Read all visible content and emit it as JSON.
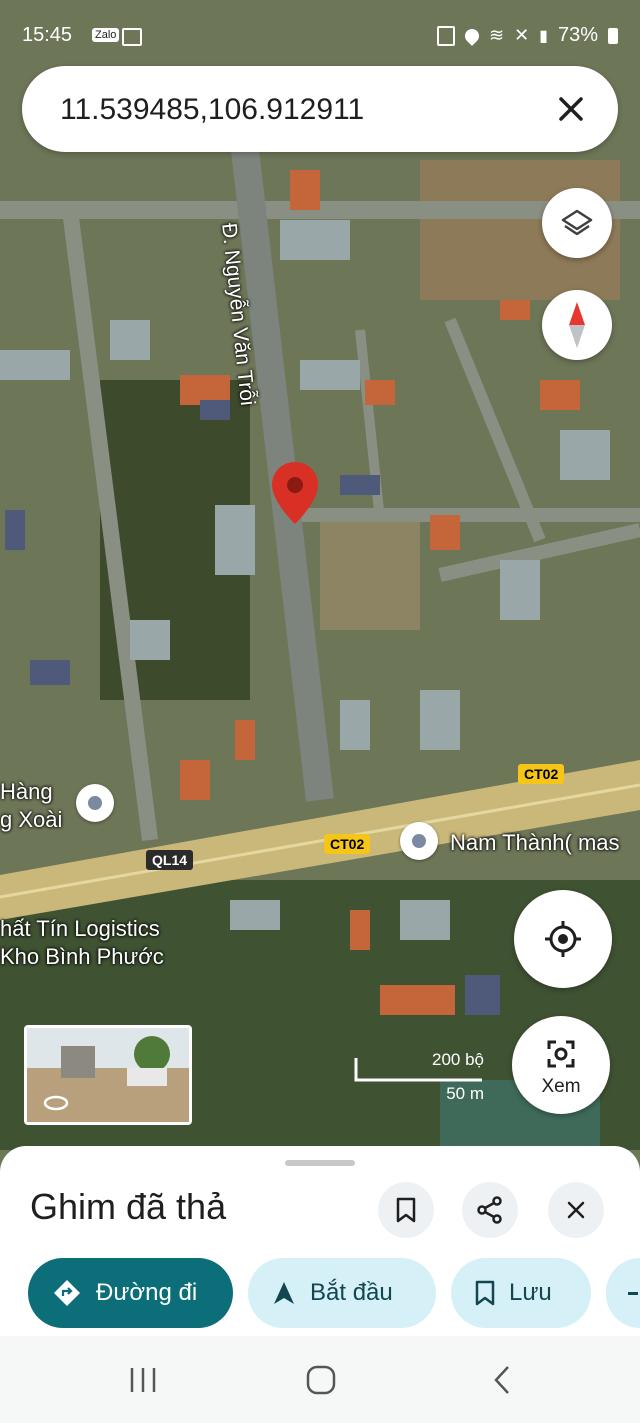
{
  "status_bar": {
    "time": "15:45",
    "battery": "73%",
    "app_badge": "Zalo"
  },
  "search": {
    "value": "11.539485,106.912911"
  },
  "map": {
    "road_label": "Đ. Nguyễn Văn Trỗi",
    "road_shields": [
      "CT02",
      "CT02",
      "QL14"
    ],
    "places": [
      {
        "name": "Hàng\ng Xoài"
      },
      {
        "name": "Nam Thành( mas"
      },
      {
        "name": "hất Tín Logistics\nKho Bình Phước"
      }
    ],
    "scale": {
      "imperial": "200 bộ",
      "metric": "50 m"
    },
    "view_label": "Xem"
  },
  "sheet": {
    "title": "Ghim đã thả",
    "chips": {
      "directions": "Đường đi",
      "start": "Bắt đầu",
      "save": "Lưu"
    }
  },
  "colors": {
    "accent": "#0b6e78",
    "pin": "#d93025",
    "chip_tonal": "#d6f0f7"
  }
}
